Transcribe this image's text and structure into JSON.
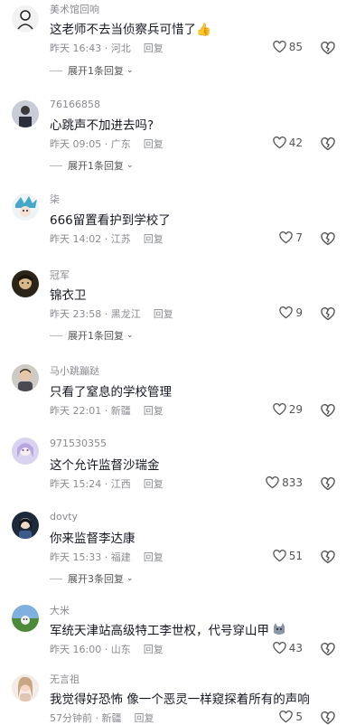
{
  "comments": [
    {
      "username": "美术馆回响",
      "text": "这老师不去当侦察兵可惜了",
      "emoji": "👍",
      "time": "昨天 16:43",
      "location": "河北",
      "reply": "回复",
      "likes": "85",
      "expand": "展开1条回复"
    },
    {
      "username": "76166858",
      "text": "心跳声不加进去吗?",
      "time": "昨天 09:05",
      "location": "广东",
      "reply": "回复",
      "likes": "42",
      "expand": "展开1条回复"
    },
    {
      "username": "柒",
      "text": "666留置看护到学校了",
      "time": "昨天 14:02",
      "location": "江苏",
      "reply": "回复",
      "likes": "7"
    },
    {
      "username": "冠军",
      "text": "锦衣卫",
      "time": "昨天 23:58",
      "location": "黑龙江",
      "reply": "回复",
      "likes": "9",
      "expand": "展开1条回复"
    },
    {
      "username": "马小跳蹦跶",
      "text": "只看了窒息的学校管理",
      "time": "昨天 22:01",
      "location": "新疆",
      "reply": "回复",
      "likes": "29"
    },
    {
      "username": "971530355",
      "text": "这个允许监督沙瑞金",
      "time": "昨天 15:24",
      "location": "江西",
      "reply": "回复",
      "likes": "833"
    },
    {
      "username": "dovty",
      "text": "你来监督李达康",
      "time": "昨天 15:33",
      "location": "福建",
      "reply": "回复",
      "likes": "51",
      "expand": "展开3条回复"
    },
    {
      "username": "大米",
      "text": "军统天津站高级特工李世权，代号穿山甲",
      "time": "昨天 16:00",
      "location": "山东",
      "reply": "回复",
      "likes": "43"
    },
    {
      "username": "无言祖",
      "text": "我觉得好恐怖 像一个恶灵一样窥探着所有的声响",
      "time": "57分钟前",
      "location": "新疆",
      "reply": "回复",
      "likes": "5"
    }
  ],
  "colors": {
    "text": "#161823",
    "meta": "#8a8b91",
    "icon": "#8a8b91"
  }
}
